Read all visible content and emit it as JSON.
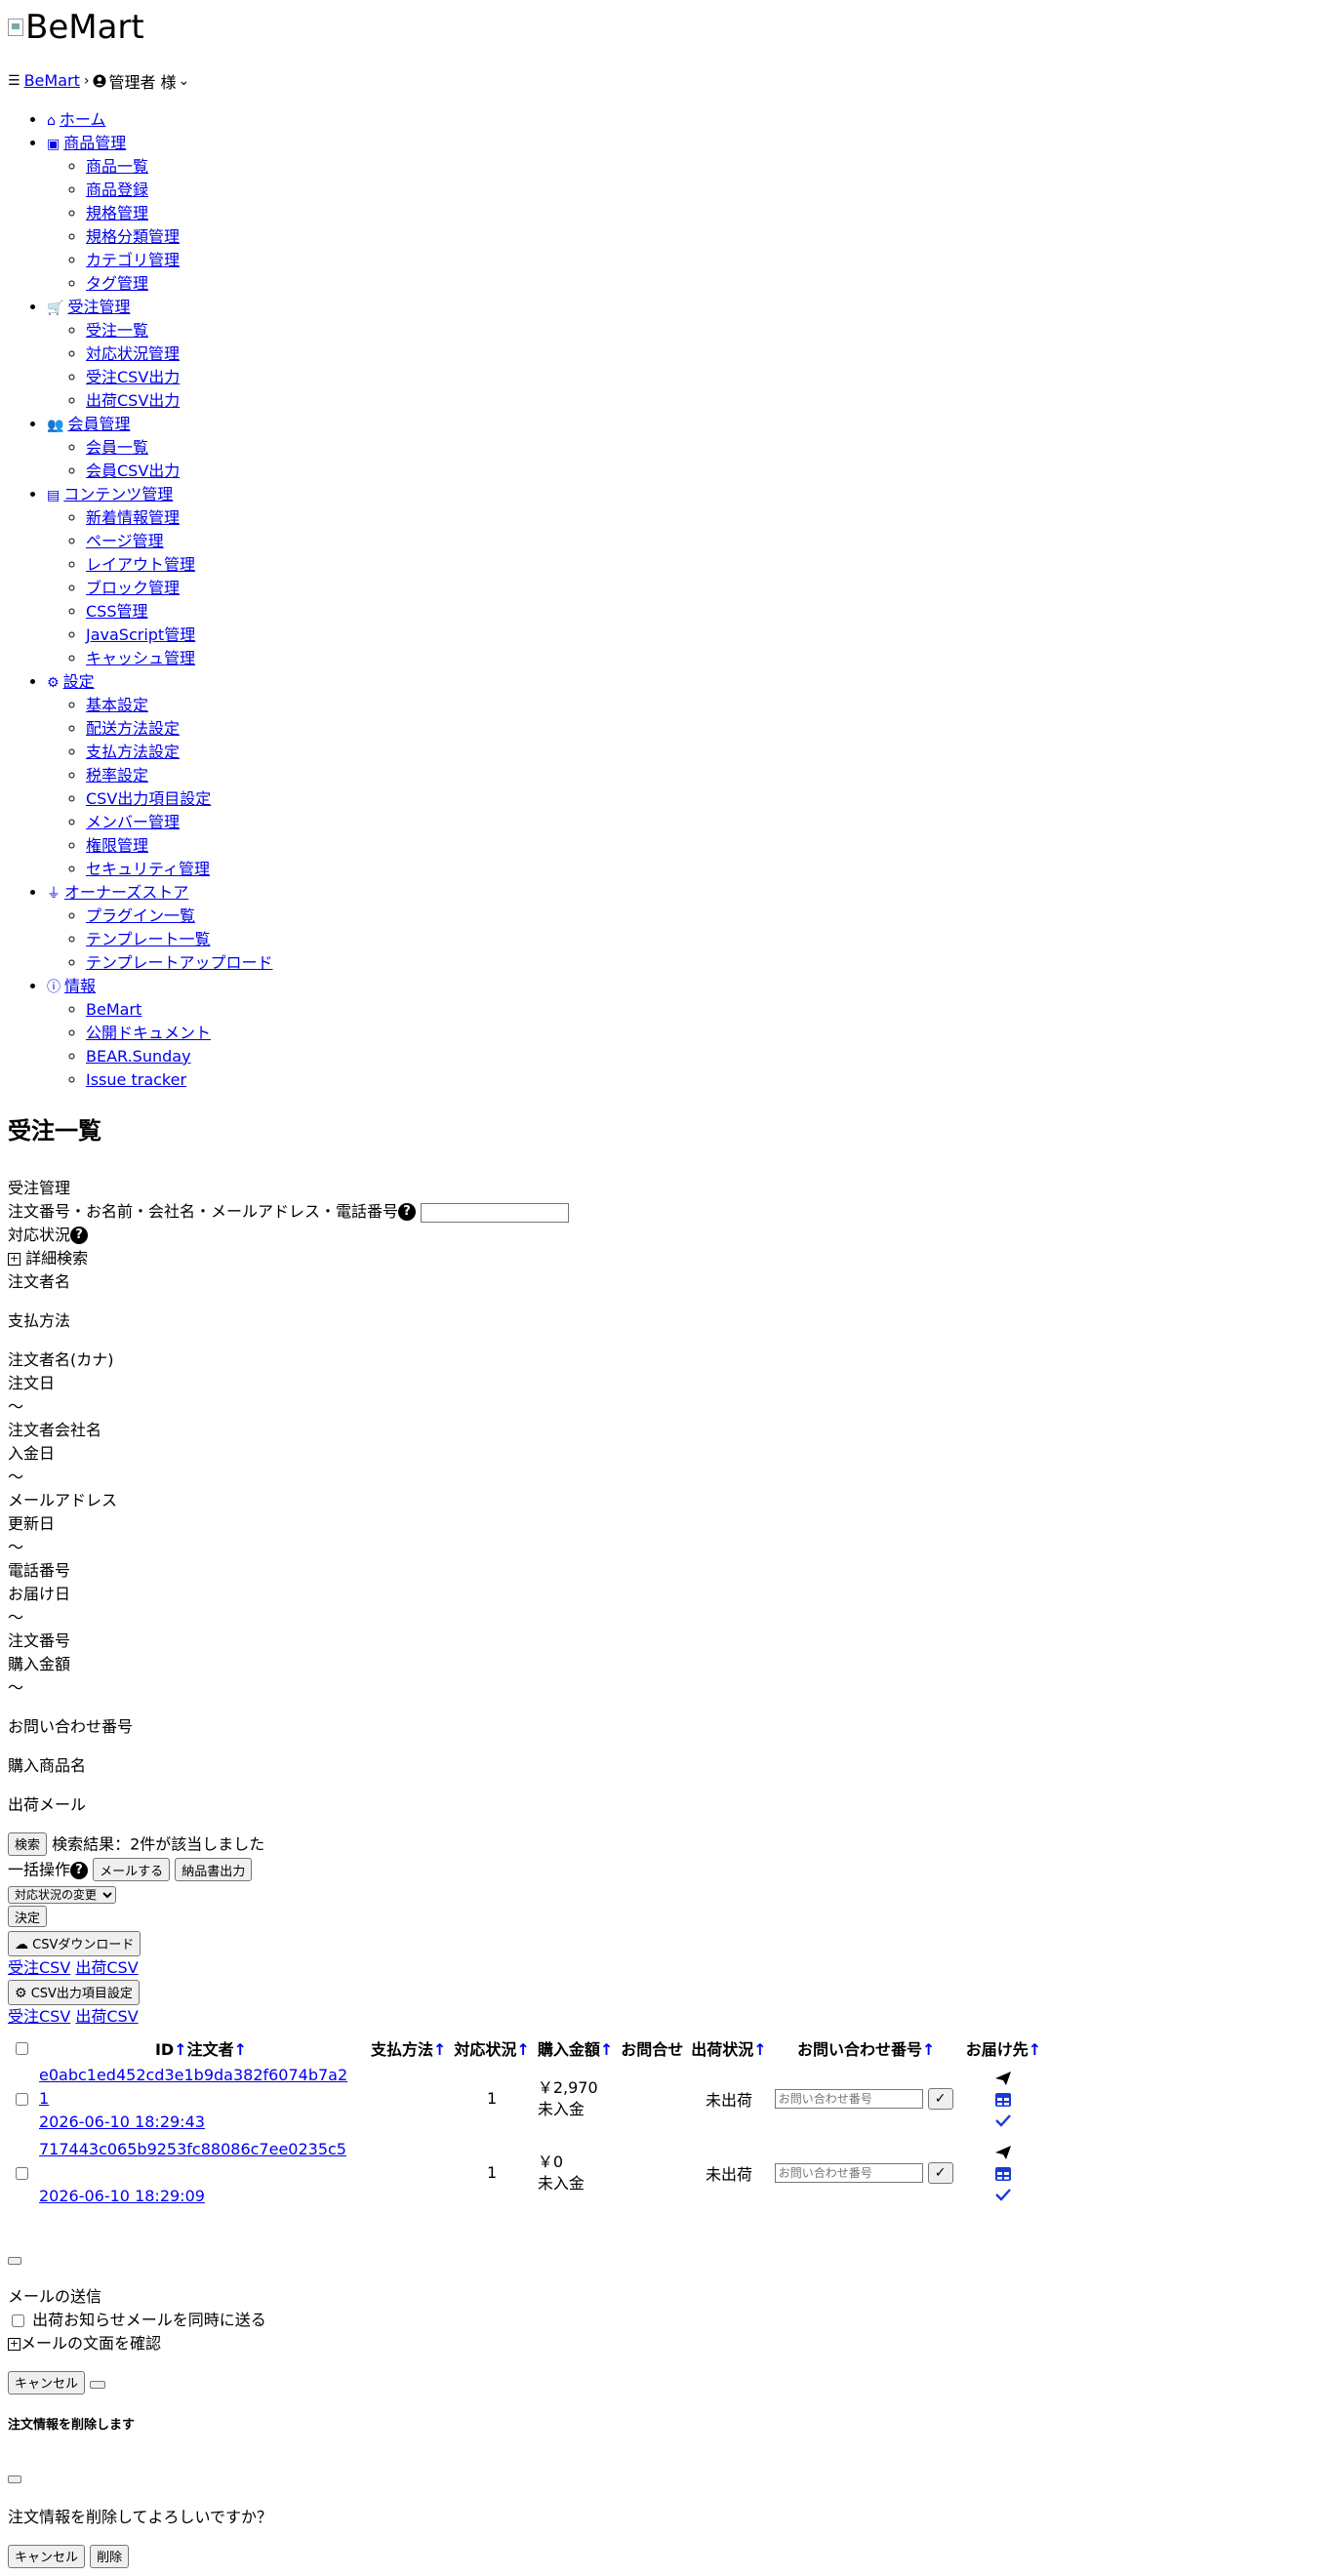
{
  "logo": {
    "alt": "BeMart"
  },
  "header": {
    "brand": "BeMart",
    "user": "管理者 様"
  },
  "nav": [
    {
      "label": "ホーム",
      "icon": "home-icon",
      "children": []
    },
    {
      "label": "商品管理",
      "icon": "box-icon",
      "children": [
        "商品一覧",
        "商品登録",
        "規格管理",
        "規格分類管理",
        "カテゴリ管理",
        "タグ管理"
      ]
    },
    {
      "label": "受注管理",
      "icon": "cart-icon",
      "children": [
        "受注一覧",
        "対応状況管理",
        "受注CSV出力",
        "出荷CSV出力"
      ]
    },
    {
      "label": "会員管理",
      "icon": "users-icon",
      "children": [
        "会員一覧",
        "会員CSV出力"
      ]
    },
    {
      "label": "コンテンツ管理",
      "icon": "file-icon",
      "children": [
        "新着情報管理",
        "ページ管理",
        "レイアウト管理",
        "ブロック管理",
        "CSS管理",
        "JavaScript管理",
        "キャッシュ管理"
      ]
    },
    {
      "label": "設定",
      "icon": "gear-icon",
      "children": [
        "基本設定",
        "配送方法設定",
        "支払方法設定",
        "税率設定",
        "CSV出力項目設定",
        "メンバー管理",
        "権限管理",
        "セキュリティ管理"
      ]
    },
    {
      "label": "オーナーズストア",
      "icon": "plug-icon",
      "children": [
        "プラグイン一覧",
        "テンプレート一覧",
        "テンプレートアップロード"
      ]
    },
    {
      "label": "情報",
      "icon": "info-icon",
      "children": [
        "BeMart",
        "公開ドキュメント",
        "BEAR.Sunday",
        "Issue tracker"
      ]
    }
  ],
  "page_title": "受注一覧",
  "section_label": "受注管理",
  "search": {
    "keyword_label": "注文番号・お名前・会社名・メールアドレス・電話番号",
    "status_label": "対応状況",
    "advanced_label": "詳細検索",
    "orderer_name": "注文者名",
    "payment_method": "支払方法",
    "orderer_kana": "注文者名(カナ)",
    "order_date": "注文日",
    "range_sep": "〜",
    "company_name": "注文者会社名",
    "payment_date": "入金日",
    "email": "メールアドレス",
    "update_date": "更新日",
    "phone": "電話番号",
    "delivery_date": "お届け日",
    "order_no": "注文番号",
    "purchase_amount": "購入金額",
    "inquiry_no": "お問い合わせ番号",
    "product_name": "購入商品名",
    "shipping_mail": "出荷メール",
    "search_button": "検索",
    "result_text": "検索結果：2件が該当しました"
  },
  "bulk": {
    "label": "一括操作",
    "mail_button": "メールする",
    "invoice_button": "納品書出力",
    "status_select": "対応状況の変更",
    "decide_button": "決定",
    "csv_download": "CSVダウンロード",
    "order_csv": "受注CSV",
    "ship_csv": "出荷CSV",
    "csv_settings": "CSV出力項目設定"
  },
  "table": {
    "headers": {
      "id": "ID",
      "orderer": "注文者",
      "payment": "支払方法",
      "status": "対応状況",
      "amount": "購入金額",
      "inquiry": "お問合せ",
      "ship_status": "出荷状況",
      "tracking": "お問い合わせ番号",
      "destination": "お届け先"
    },
    "tracking_placeholder": "お問い合わせ番号",
    "rows": [
      {
        "id_line1": "e0abc1ed452cd3e1b9da382f6074b7a2",
        "id_line2": "1",
        "date": "2026-06-10 18:29:43",
        "status": "1",
        "amount": "￥2,970",
        "payment_state": "未入金",
        "ship_status": "未出荷"
      },
      {
        "id_line1": "717443c065b9253fc88086c7ee0235c5",
        "id_line2": "",
        "date": "2026-06-10 18:29:09",
        "status": "1",
        "amount": "￥0",
        "payment_state": "未入金",
        "ship_status": "未出荷"
      }
    ]
  },
  "mail_modal": {
    "title": "メールの送信",
    "notify_label": "出荷お知らせメールを同時に送る",
    "preview_label": "メールの文面を確認",
    "cancel": "キャンセル"
  },
  "delete_modal": {
    "title": "注文情報を削除します",
    "message": "注文情報を削除してよろしいですか？",
    "cancel": "キャンセル",
    "delete": "削除"
  }
}
